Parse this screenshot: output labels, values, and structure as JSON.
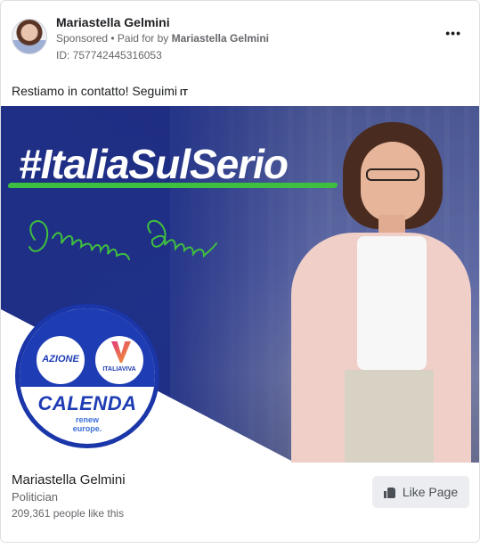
{
  "post": {
    "page_name": "Mariastella Gelmini",
    "sponsored_label": "Sponsored",
    "separator": " • ",
    "paid_for_prefix": "Paid for by ",
    "paid_for_by": "Mariastella Gelmini",
    "ad_id": "ID: 757742445316053",
    "more_label": "•••",
    "text": "Restiamo in contatto! Seguimi",
    "language_badge": "IT"
  },
  "creative": {
    "hashtag": "#ItaliaSulSerio",
    "signature": "Mariastella Gelmini",
    "logo": {
      "azione": "AZIONE",
      "italia_viva": "ITALIAVIVA",
      "calenda": "CALENDA",
      "renew_line1": "renew",
      "renew_line2": "europe."
    },
    "colors": {
      "background": "#223493",
      "accent_green": "#3fbf3f",
      "logo_blue": "#1e3cb3"
    }
  },
  "footer": {
    "page_name": "Mariastella Gelmini",
    "category": "Politician",
    "likes": "209,361 people like this",
    "like_button": "Like Page",
    "like_icon": "thumbs-up-icon"
  }
}
